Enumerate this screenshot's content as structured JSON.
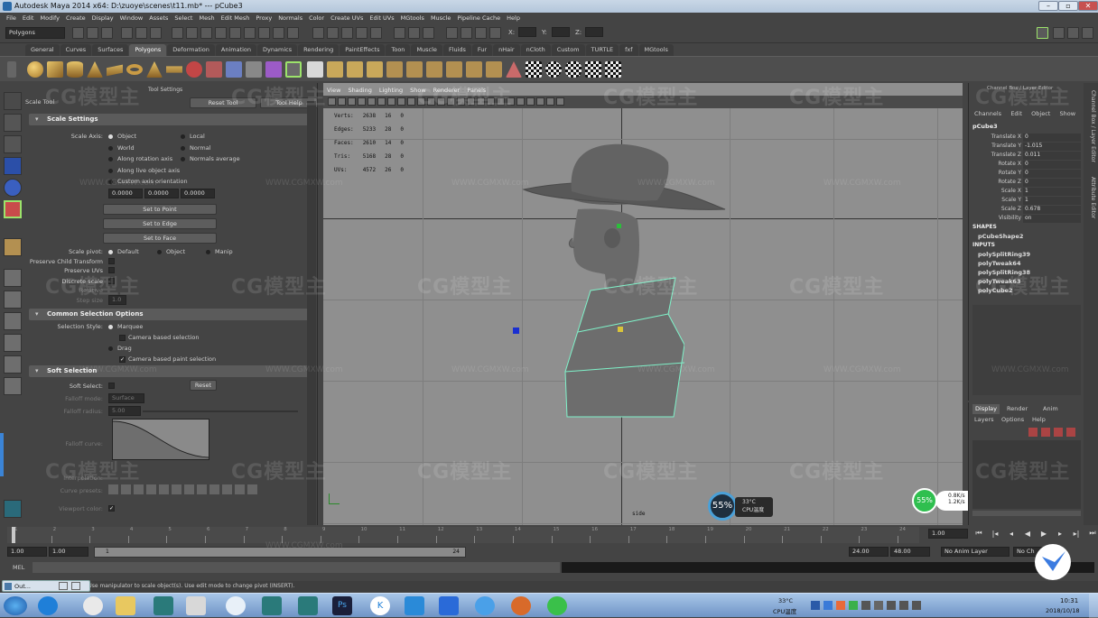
{
  "window": {
    "title": "Autodesk Maya 2014 x64: D:\\zuoye\\scenes\\t11.mb*   ---   pCube3"
  },
  "menubar": [
    "File",
    "Edit",
    "Modify",
    "Create",
    "Display",
    "Window",
    "Assets",
    "Select",
    "Mesh",
    "Edit Mesh",
    "Proxy",
    "Normals",
    "Color",
    "Create UVs",
    "Edit UVs",
    "MGtools",
    "Muscle",
    "Pipeline Cache",
    "Help"
  ],
  "status": {
    "mode": "Polygons",
    "x_label": "X:",
    "y_label": "Y:",
    "z_label": "Z:"
  },
  "shelf_tabs": [
    "General",
    "Curves",
    "Surfaces",
    "Polygons",
    "Deformation",
    "Animation",
    "Dynamics",
    "Rendering",
    "PaintEffects",
    "Toon",
    "Muscle",
    "Fluids",
    "Fur",
    "nHair",
    "nCloth",
    "Custom",
    "TURTLE",
    "fxf",
    "MGtools"
  ],
  "shelf_active": "Polygons",
  "tool_settings": {
    "tool_name": "Scale Tool",
    "header": "Tool Settings",
    "reset_tool": "Reset Tool",
    "tool_help": "Tool Help",
    "scale_settings": "Scale Settings",
    "scale_axis_label": "Scale Axis:",
    "axis_options": [
      "Object",
      "Local",
      "World",
      "Normal",
      "Along rotation axis",
      "Normals average",
      "Along live object axis",
      "Custom axis orientation"
    ],
    "custom_values": [
      "0.0000",
      "0.0000",
      "0.0000"
    ],
    "set_to_point": "Set to Point",
    "set_to_edge": "Set to Edge",
    "set_to_face": "Set to Face",
    "scale_pivot_label": "Scale pivot:",
    "pivot_options": [
      "Default",
      "Object",
      "Manip"
    ],
    "preserve_child": "Preserve Child Transform",
    "preserve_uvs": "Preserve UVs",
    "discrete_scale": "Discrete scale",
    "relative": "Relative",
    "step_size": "Step size",
    "step_value": "1.0",
    "common_selection": "Common Selection Options",
    "selection_style_label": "Selection Style:",
    "marquee": "Marquee",
    "camera_based_selection": "Camera based selection",
    "drag": "Drag",
    "camera_based_paint": "Camera based paint selection",
    "soft_selection": "Soft Selection",
    "soft_select_label": "Soft Select:",
    "reset": "Reset",
    "falloff_mode": "Falloff mode:",
    "falloff_mode_value": "Surface",
    "falloff_radius": "Falloff radius:",
    "falloff_radius_value": "5.00",
    "falloff_curve": "Falloff curve:",
    "interpolation": "Interpolation:",
    "curve_presets": "Curve presets:",
    "viewport_color": "Viewport color:"
  },
  "viewport": {
    "menu": [
      "View",
      "Shading",
      "Lighting",
      "Show",
      "Renderer",
      "Panels"
    ],
    "hud": [
      {
        "label": "Verts:",
        "a": "2638",
        "b": "16",
        "c": "0"
      },
      {
        "label": "Edges:",
        "a": "5233",
        "b": "28",
        "c": "0"
      },
      {
        "label": "Faces:",
        "a": "2610",
        "b": "14",
        "c": "0"
      },
      {
        "label": "Tris:",
        "a": "5168",
        "b": "28",
        "c": "0"
      },
      {
        "label": "UVs:",
        "a": "4572",
        "b": "26",
        "c": "0"
      }
    ],
    "camera": "side"
  },
  "channel_box": {
    "title": "Channel Box / Layer Editor",
    "menu": [
      "Channels",
      "Edit",
      "Object",
      "Show"
    ],
    "object": "pCube3",
    "attrs": [
      {
        "name": "Translate X",
        "value": "0"
      },
      {
        "name": "Translate Y",
        "value": "-1.015"
      },
      {
        "name": "Translate Z",
        "value": "0.011"
      },
      {
        "name": "Rotate X",
        "value": "0"
      },
      {
        "name": "Rotate Y",
        "value": "0"
      },
      {
        "name": "Rotate Z",
        "value": "0"
      },
      {
        "name": "Scale X",
        "value": "1"
      },
      {
        "name": "Scale Y",
        "value": "1"
      },
      {
        "name": "Scale Z",
        "value": "0.678"
      },
      {
        "name": "Visibility",
        "value": "on"
      }
    ],
    "shapes_label": "SHAPES",
    "shape": "pCubeShape2",
    "inputs_label": "INPUTS",
    "inputs": [
      "polySplitRing39",
      "polyTweak64",
      "polySplitRing38",
      "polyTweak63",
      "polyCube2"
    ]
  },
  "side_tabs": [
    "Channel Box / Layer Editor",
    "Attribute Editor"
  ],
  "layers": {
    "tabs": [
      "Display",
      "Render",
      "Anim"
    ],
    "menu": [
      "Layers",
      "Options",
      "Help"
    ]
  },
  "time": {
    "ticks": [
      "1",
      "2",
      "3",
      "4",
      "5",
      "6",
      "7",
      "8",
      "9",
      "10",
      "11",
      "12",
      "13",
      "14",
      "15",
      "16",
      "17",
      "18",
      "19",
      "20",
      "21",
      "22",
      "23",
      "24"
    ],
    "current_frame": "1.00",
    "range_start": "1.00",
    "range_start2": "1.00",
    "range_inner_start": "1",
    "range_inner_end": "24",
    "range_end": "24.00",
    "range_end2": "48.00",
    "anim_layer": "No Anim Layer",
    "char_set": "No Ch"
  },
  "cmd": {
    "label": "MEL"
  },
  "help_line": "Scale tool: Use manipulator to scale object(s). Use edit mode to change pivot (INSERT).",
  "cpu_widget": {
    "percent": "55%",
    "temp": "33°C",
    "label": "CPU温度"
  },
  "net_widget": {
    "percent": "55%",
    "up": "0.8K/s",
    "down": "1.2K/s"
  },
  "taskbar": {
    "outliner": "Out...",
    "cpu_temp": "33°C",
    "cpu_label": "CPU温度",
    "time": "10:31",
    "date": "2018/10/18"
  },
  "watermark": {
    "logo": "CG模型主",
    "url": "WWW.CGMXW.com"
  },
  "colors": {
    "viewport_bg": "#8f8f8f",
    "panel_bg": "#444444",
    "selection": "#7ff2c9"
  }
}
